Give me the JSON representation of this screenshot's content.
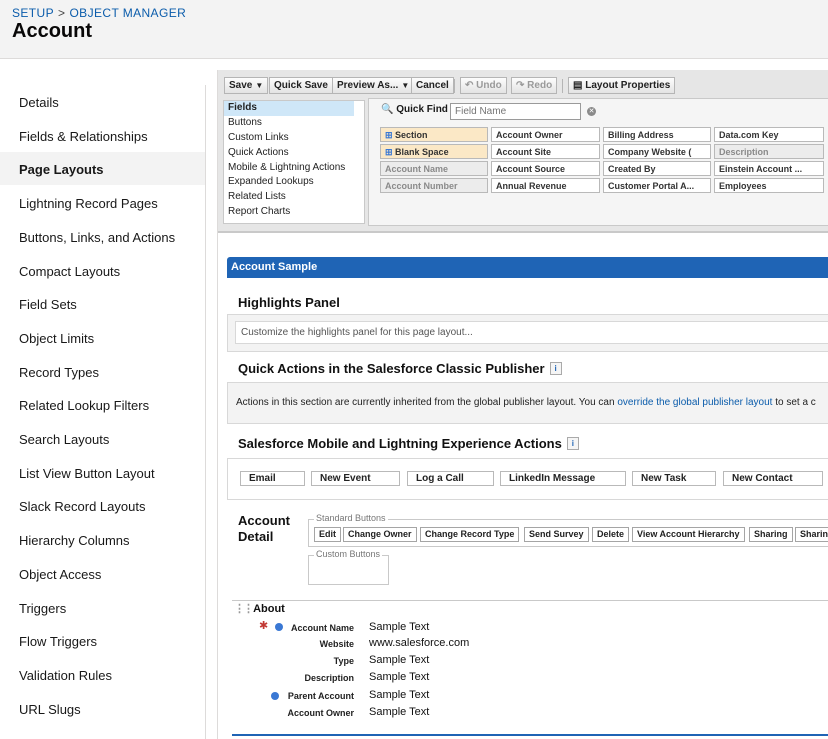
{
  "header": {
    "breadcrumb": [
      "SETUP",
      "OBJECT MANAGER"
    ],
    "breadcrumb_separator": ">",
    "title": "Account"
  },
  "sidebar": {
    "items": [
      {
        "label": "Details"
      },
      {
        "label": "Fields & Relationships"
      },
      {
        "label": "Page Layouts",
        "active": true
      },
      {
        "label": "Lightning Record Pages"
      },
      {
        "label": "Buttons, Links, and Actions"
      },
      {
        "label": "Compact Layouts"
      },
      {
        "label": "Field Sets"
      },
      {
        "label": "Object Limits"
      },
      {
        "label": "Record Types"
      },
      {
        "label": "Related Lookup Filters"
      },
      {
        "label": "Search Layouts"
      },
      {
        "label": "List View Button Layout"
      },
      {
        "label": "Slack Record Layouts"
      },
      {
        "label": "Hierarchy Columns"
      },
      {
        "label": "Object Access"
      },
      {
        "label": "Triggers"
      },
      {
        "label": "Flow Triggers"
      },
      {
        "label": "Validation Rules"
      },
      {
        "label": "URL Slugs"
      }
    ]
  },
  "toolbar": {
    "save": "Save",
    "quick_save": "Quick Save",
    "preview_as": "Preview As...",
    "cancel": "Cancel",
    "undo": "Undo",
    "redo": "Redo",
    "layout_properties": "Layout Properties"
  },
  "palette": {
    "categories": [
      "Fields",
      "Buttons",
      "Custom Links",
      "Quick Actions",
      "Mobile & Lightning Actions",
      "Expanded Lookups",
      "Related Lists",
      "Report Charts"
    ],
    "quick_find_label": "Quick Find",
    "quick_find_placeholder": "Field Name",
    "field_rows": [
      [
        "Section",
        "Account Owner",
        "Billing Address",
        "Data.com Key"
      ],
      [
        "Blank Space",
        "Account Site",
        "Company Website (",
        "Description"
      ],
      [
        "Account Name",
        "Account Source",
        "Created By",
        "Einstein Account ..."
      ],
      [
        "Account Number",
        "Annual Revenue",
        "Customer Portal A...",
        "Employees"
      ]
    ]
  },
  "layout": {
    "header": "Account Sample",
    "highlights_title": "Highlights Panel",
    "highlights_text": "Customize the highlights panel for this page layout...",
    "quick_actions_title": "Quick Actions in the Salesforce Classic Publisher",
    "quick_actions_text_1": "Actions in this section are currently inherited from the global publisher layout. You can",
    "quick_actions_link": "override the global publisher layout",
    "quick_actions_text_2": "to set a c",
    "mobile_actions_title": "Salesforce Mobile and Lightning Experience Actions",
    "mobile_actions": [
      "Email",
      "New Event",
      "Log a Call",
      "LinkedIn Message",
      "New Task",
      "New Contact"
    ],
    "detail_title_1": "Account",
    "detail_title_2": "Detail",
    "standard_buttons_label": "Standard Buttons",
    "standard_buttons": [
      "Edit",
      "Change Owner",
      "Change Record Type",
      "Send Survey",
      "Delete",
      "View Account Hierarchy",
      "Sharing",
      "Sharin"
    ],
    "custom_buttons_label": "Custom Buttons",
    "about_title": "About",
    "about_fields": [
      {
        "label": "Account Name",
        "value": "Sample Text"
      },
      {
        "label": "Website",
        "value": "www.salesforce.com"
      },
      {
        "label": "Type",
        "value": "Sample Text"
      },
      {
        "label": "Description",
        "value": "Sample Text"
      },
      {
        "label": "Parent Account",
        "value": "Sample Text"
      },
      {
        "label": "Account Owner",
        "value": "Sample Text"
      }
    ]
  }
}
